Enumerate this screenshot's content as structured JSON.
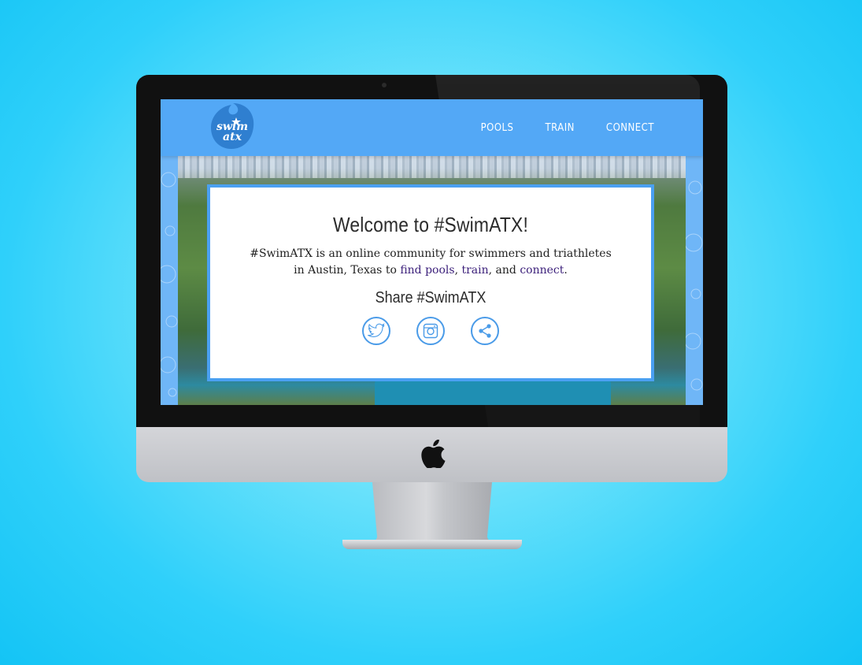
{
  "site": {
    "logo_line1": "swim",
    "logo_line2": "atx"
  },
  "nav": {
    "items": [
      {
        "label": "POOLS"
      },
      {
        "label": "TRAIN"
      },
      {
        "label": "CONNECT"
      }
    ]
  },
  "hero": {
    "title": "Welcome to #SwimATX!",
    "intro_prefix": "#SwimATX is an online community for swimmers and triathletes in Austin, Texas to ",
    "link_find_pools": "find pools",
    "sep1": ", ",
    "link_train": "train",
    "sep2": ", and ",
    "link_connect": "connect",
    "suffix": ".",
    "share_heading": "Share #SwimATX"
  },
  "colors": {
    "background": "#2fd0fa",
    "navbar": "#53a8f6",
    "card_border": "#4aa0f2",
    "link": "#3b1f7a"
  },
  "icons": [
    "twitter-icon",
    "instagram-icon",
    "share-icon",
    "apple-logo-icon"
  ]
}
